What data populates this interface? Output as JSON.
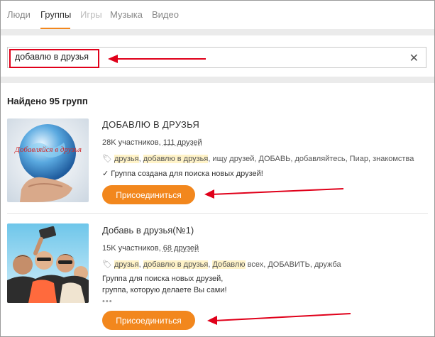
{
  "tabs": [
    {
      "label": "Люди"
    },
    {
      "label": "Группы"
    },
    {
      "label": "Игры"
    },
    {
      "label": "Музыка"
    },
    {
      "label": "Видео"
    }
  ],
  "search": {
    "value": "добавлю в друзья",
    "clear_icon": "close-icon"
  },
  "results": {
    "title": "Найдено 95 групп"
  },
  "groups": [
    {
      "name": "ДОБАВЛЮ В ДРУЗЬЯ",
      "members": "28K участников,",
      "friends": "111 друзей",
      "tags_hl": [
        "друзья",
        "добавлю в друзья"
      ],
      "tags_rest": ", ищу друзей, ДОБАВЬ, добавляйтесь, Пиар, знакомства",
      "description": "✓ Группа создана для поиска новых друзей!",
      "image_text": "Добавляйся в друзья",
      "join_label": "Присоединиться"
    },
    {
      "name": "Добавь в друзья(№1)",
      "members": "15K участников,",
      "friends": "68 друзей",
      "tags_hl": [
        "друзья",
        "добавлю в друзья",
        "Добавлю"
      ],
      "tags_rest": " всех, ДОБАВИТЬ, дружба",
      "description_line1": "Группа для поиска новых друзей,",
      "description_line2": "группа, которую делаете Вы сами!",
      "more": "•••",
      "join_label": "Присоединиться"
    }
  ],
  "colors": {
    "accent": "#f2871d",
    "highlight": "#e0001a",
    "tag_bg": "#fff3c8"
  }
}
